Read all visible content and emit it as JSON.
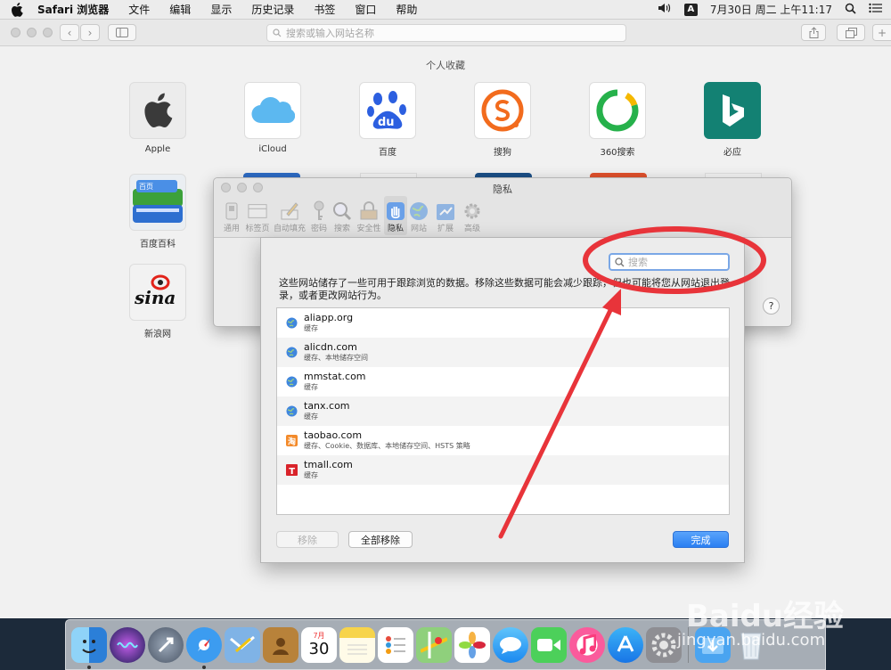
{
  "menubar": {
    "app_name": "Safari 浏览器",
    "items": [
      "文件",
      "编辑",
      "显示",
      "历史记录",
      "书签",
      "窗口",
      "帮助"
    ],
    "input_method": "A",
    "clock": "7月30日 周二 上午11:17"
  },
  "safari": {
    "address_placeholder": "搜索或输入网站名称",
    "favorites_title": "个人收藏",
    "favorites": [
      {
        "label": "Apple"
      },
      {
        "label": "iCloud"
      },
      {
        "label": "百度"
      },
      {
        "label": "搜狗"
      },
      {
        "label": "360搜索"
      },
      {
        "label": "必应"
      },
      {
        "label": "百度百科"
      },
      {
        "label": "新浪网"
      }
    ]
  },
  "prefs": {
    "title": "隐私",
    "tabs": [
      "通用",
      "标签页",
      "自动填充",
      "密码",
      "搜索",
      "安全性",
      "隐私",
      "网站",
      "扩展",
      "高级"
    ],
    "active_tab": "隐私",
    "help_label": "?"
  },
  "sheet": {
    "search_placeholder": "搜索",
    "description": "这些网站储存了一些可用于跟踪浏览的数据。移除这些数据可能会减少跟踪，但也可能将您从网站退出登录，或者更改网站行为。",
    "sites": [
      {
        "host": "aliapp.org",
        "detail": "缓存",
        "icon": "globe-icon"
      },
      {
        "host": "alicdn.com",
        "detail": "缓存、本地储存空间",
        "icon": "globe-icon"
      },
      {
        "host": "mmstat.com",
        "detail": "缓存",
        "icon": "globe-icon"
      },
      {
        "host": "tanx.com",
        "detail": "缓存",
        "icon": "globe-icon"
      },
      {
        "host": "taobao.com",
        "detail": "缓存、Cookie、数据库、本地储存空间、HSTS 策略",
        "icon": "taobao-icon"
      },
      {
        "host": "tmall.com",
        "detail": "缓存",
        "icon": "tmall-icon"
      }
    ],
    "remove_label": "移除",
    "remove_all_label": "全部移除",
    "done_label": "完成"
  },
  "dock": {
    "calendar_month": "7月",
    "calendar_day": "30",
    "apps": [
      "finder-icon",
      "siri-icon",
      "launchpad-icon",
      "safari-icon",
      "mail-icon",
      "contacts-icon",
      "calendar-icon",
      "notes-icon",
      "reminders-icon",
      "maps-icon",
      "photos-icon",
      "messages-icon",
      "facetime-icon",
      "music-icon",
      "appstore-icon",
      "system-preferences-icon",
      "downloads-icon",
      "trash-icon"
    ]
  },
  "watermark": {
    "brand": "Baidu经验",
    "url": "jingyan.baidu.com"
  },
  "colors": {
    "annotation_red": "#e8343a",
    "accent_blue": "#2a7ff2"
  }
}
